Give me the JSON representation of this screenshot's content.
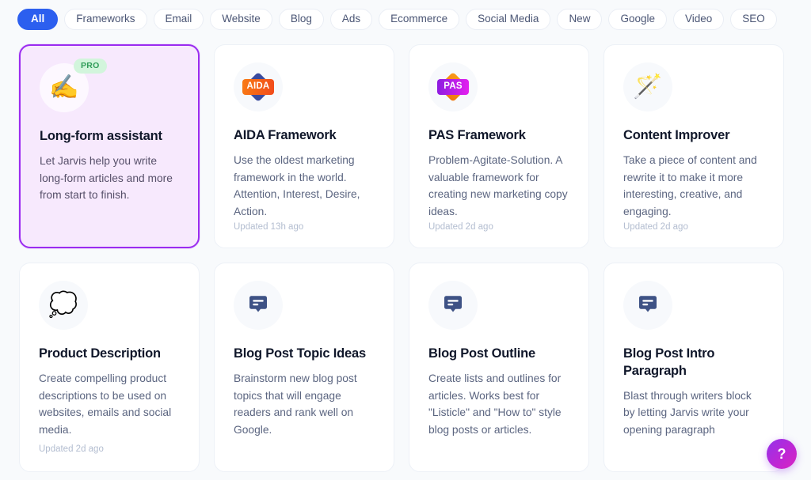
{
  "filters": {
    "items": [
      {
        "label": "All",
        "active": true
      },
      {
        "label": "Frameworks",
        "active": false
      },
      {
        "label": "Email",
        "active": false
      },
      {
        "label": "Website",
        "active": false
      },
      {
        "label": "Blog",
        "active": false
      },
      {
        "label": "Ads",
        "active": false
      },
      {
        "label": "Ecommerce",
        "active": false
      },
      {
        "label": "Social Media",
        "active": false
      },
      {
        "label": "New",
        "active": false
      },
      {
        "label": "Google",
        "active": false
      },
      {
        "label": "Video",
        "active": false
      },
      {
        "label": "SEO",
        "active": false
      }
    ]
  },
  "cards": [
    {
      "title": "Long-form assistant",
      "description": "Let Jarvis help you write long-form articles and more from start to finish.",
      "updated": "",
      "badge": "PRO",
      "icon": "writing-hand-emoji",
      "icon_glyph": "✍️",
      "featured": true
    },
    {
      "title": "AIDA Framework",
      "description": "Use the oldest marketing framework in the world. Attention, Interest, Desire, Action.",
      "updated": "Updated 13h ago",
      "badge": "",
      "icon": "aida-badge-icon",
      "icon_text": "AIDA",
      "featured": false
    },
    {
      "title": "PAS Framework",
      "description": "Problem-Agitate-Solution. A valuable framework for creating new marketing copy ideas.",
      "updated": "Updated 2d ago",
      "badge": "",
      "icon": "pas-badge-icon",
      "icon_text": "PAS",
      "featured": false
    },
    {
      "title": "Content Improver",
      "description": "Take a piece of content and rewrite it to make it more interesting, creative, and engaging.",
      "updated": "Updated 2d ago",
      "badge": "",
      "icon": "magic-wand-emoji",
      "icon_glyph": "🪄",
      "featured": false
    },
    {
      "title": "Product Description",
      "description": "Create compelling product descriptions to be used on websites, emails and social media.",
      "updated": "Updated 2d ago",
      "badge": "",
      "icon": "thought-balloon-emoji",
      "icon_glyph": "💭",
      "featured": false
    },
    {
      "title": "Blog Post Topic Ideas",
      "description": "Brainstorm new blog post topics that will engage readers and rank well on Google.",
      "updated": "",
      "badge": "",
      "icon": "speech-bubble-icon",
      "featured": false
    },
    {
      "title": "Blog Post Outline",
      "description": "Create lists and outlines for articles. Works best for \"Listicle\" and \"How to\" style blog posts or articles.",
      "updated": "",
      "badge": "",
      "icon": "speech-bubble-icon",
      "featured": false
    },
    {
      "title": "Blog Post Intro Paragraph",
      "description": "Blast through writers block by letting Jarvis write your opening paragraph",
      "updated": "",
      "badge": "",
      "icon": "speech-bubble-icon",
      "featured": false
    }
  ],
  "help": {
    "label": "?"
  },
  "colors": {
    "page_background": "#f8fafc",
    "accent_blue": "#2c5fef",
    "featured_border": "#9b2cf0",
    "featured_background": "#f7e9fd",
    "pro_badge_background": "#d2f5dc",
    "pro_badge_text": "#2f9c58",
    "card_title": "#10172a",
    "card_description": "#5b6580",
    "updated_text": "#b3bdd0",
    "bubble_icon": "#3e5285",
    "help_gradient_start": "#9333ea",
    "help_gradient_end": "#d926c0"
  }
}
